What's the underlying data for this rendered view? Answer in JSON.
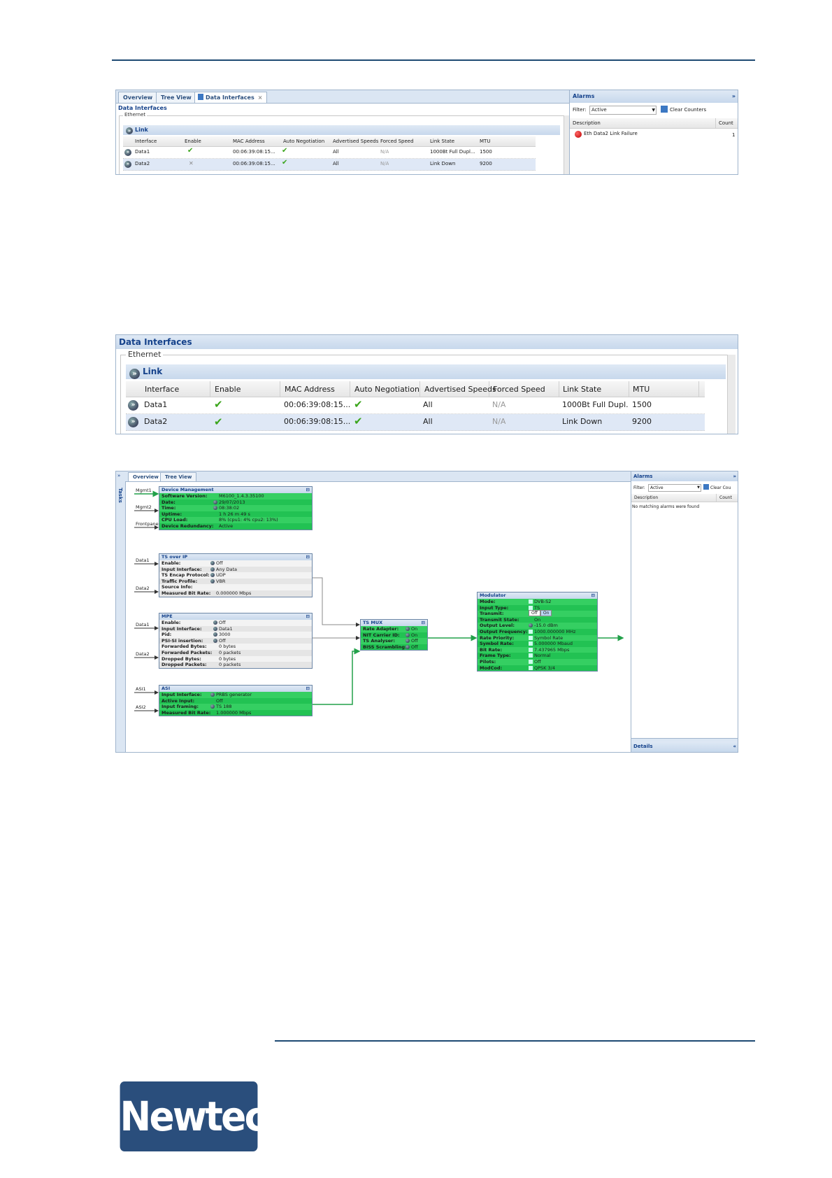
{
  "shot1": {
    "tabs": [
      "Overview",
      "Tree View",
      "Data Interfaces"
    ],
    "panel_title": "Data Interfaces",
    "group": "Ethernet",
    "section": "Link",
    "columns": [
      "Interface",
      "Enable",
      "MAC Address",
      "Auto Negotiation",
      "Advertised Speeds",
      "Forced Speed",
      "Link State",
      "MTU"
    ],
    "rows": [
      {
        "interface": "Data1",
        "mac": "00:06:39:08:15...",
        "speeds": "All",
        "forced": "N/A",
        "state": "1000Bt Full Dupl...",
        "mtu": "1500"
      },
      {
        "interface": "Data2",
        "mac": "00:06:39:08:15...",
        "speeds": "All",
        "forced": "N/A",
        "state": "Link Down",
        "mtu": "9200"
      }
    ],
    "alarms": {
      "title": "Alarms",
      "filter_label": "Filter:",
      "filter_value": "Active",
      "clear": "Clear Counters",
      "col_desc": "Description",
      "col_count": "Count",
      "item": "Eth Data2 Link Failure",
      "item_count": "1"
    }
  },
  "shot2": {
    "panel_title": "Data Interfaces",
    "group": "Ethernet",
    "section": "Link",
    "columns": [
      "Interface",
      "Enable",
      "MAC Address",
      "Auto Negotiation",
      "Advertised Speeds",
      "Forced Speed",
      "Link State",
      "MTU"
    ],
    "rows": [
      {
        "interface": "Data1",
        "mac": "00:06:39:08:15...",
        "speeds": "All",
        "forced": "N/A",
        "state": "1000Bt Full Dupl...",
        "mtu": "1500"
      },
      {
        "interface": "Data2",
        "mac": "00:06:39:08:15...",
        "speeds": "All",
        "forced": "N/A",
        "state": "Link Down",
        "mtu": "9200"
      }
    ]
  },
  "shot3": {
    "tabs": [
      "Overview",
      "Tree View"
    ],
    "side_label": "Tasks",
    "inputs": {
      "mgmt1": "Mgmt1",
      "mgmt2": "Mgmt2",
      "frontpanel": "Frontpane",
      "data1a": "Data1",
      "data2a": "Data2",
      "data1b": "Data1",
      "data2b": "Data2",
      "asi1": "ASI1",
      "asi2": "ASI2"
    },
    "device": {
      "title": "Device Management",
      "rows": [
        {
          "k": "Software Version:",
          "v": "M6100_1.4.3.35100"
        },
        {
          "k": "Date:",
          "v": "29/07/2013"
        },
        {
          "k": "Time:",
          "v": "08:38:02"
        },
        {
          "k": "Uptime:",
          "v": "1 h 26 m 49 s"
        },
        {
          "k": "CPU Load:",
          "v": "8% (cpu1: 4% cpu2: 13%)"
        },
        {
          "k": "Device Redundancy:",
          "v": "Active"
        }
      ]
    },
    "tsip": {
      "title": "TS over IP",
      "rows": [
        {
          "k": "Enable:",
          "v": "Off"
        },
        {
          "k": "Input Interface:",
          "v": "Any Data"
        },
        {
          "k": "TS Encap Protocol:",
          "v": "UDP"
        },
        {
          "k": "Traffic Profile:",
          "v": "VBR"
        },
        {
          "k": "Source Info:",
          "v": ""
        },
        {
          "k": "Measured Bit Rate:",
          "v": "0.000000 Mbps"
        }
      ]
    },
    "mpe": {
      "title": "MPE",
      "rows": [
        {
          "k": "Enable:",
          "v": "Off"
        },
        {
          "k": "Input Interface:",
          "v": "Data1"
        },
        {
          "k": "Pid:",
          "v": "3000"
        },
        {
          "k": "PSI-SI insertion:",
          "v": "Off"
        },
        {
          "k": "Forwarded Bytes:",
          "v": "0 bytes"
        },
        {
          "k": "Forwarded Packets:",
          "v": "0 packets"
        },
        {
          "k": "Dropped Bytes:",
          "v": "0 bytes"
        },
        {
          "k": "Dropped Packets:",
          "v": "0 packets"
        }
      ]
    },
    "asi": {
      "title": "ASI",
      "rows": [
        {
          "k": "Input Interface:",
          "v": "PRBS generator"
        },
        {
          "k": "Active Input:",
          "v": "Off"
        },
        {
          "k": "Input framing:",
          "v": "TS 188"
        },
        {
          "k": "Measured Bit Rate:",
          "v": "1.000000 Mbps"
        }
      ]
    },
    "tsmux": {
      "title": "TS MUX",
      "rows": [
        {
          "k": "Rate Adapter:",
          "v": "On"
        },
        {
          "k": "NIT Carrier ID:",
          "v": "On"
        },
        {
          "k": "TS Analyser:",
          "v": "Off"
        },
        {
          "k": "BISS Scrambling:",
          "v": "Off"
        }
      ]
    },
    "modulator": {
      "title": "Modulator",
      "rows": [
        {
          "k": "Mode:",
          "v": "DVB-S2"
        },
        {
          "k": "Input Type:",
          "v": "TS"
        },
        {
          "k": "Transmit:",
          "v": ""
        },
        {
          "k": "Transmit State:",
          "v": "On"
        },
        {
          "k": "Output Level:",
          "v": "-15.0 dBm"
        },
        {
          "k": "Output Frequency:",
          "v": "1000.000000 MHz"
        },
        {
          "k": "Rate Priority:",
          "v": "Symbol Rate"
        },
        {
          "k": "Symbol Rate:",
          "v": "5.000000 Mbaud"
        },
        {
          "k": "Bit Rate:",
          "v": "7.437965 Mbps"
        },
        {
          "k": "Frame Type:",
          "v": "Normal"
        },
        {
          "k": "Pilots:",
          "v": "Off"
        },
        {
          "k": "ModCod:",
          "v": "QPSK 3/4"
        }
      ],
      "toggle_off": "Off",
      "toggle_on": "On"
    },
    "alarms": {
      "title": "Alarms",
      "filter_label": "Filter:",
      "filter_value": "Active",
      "clear": "Clear Cou",
      "col_desc": "Description",
      "col_count": "Count",
      "empty": "No matching alarms were found",
      "details": "Details"
    }
  },
  "logo": "Newtec"
}
